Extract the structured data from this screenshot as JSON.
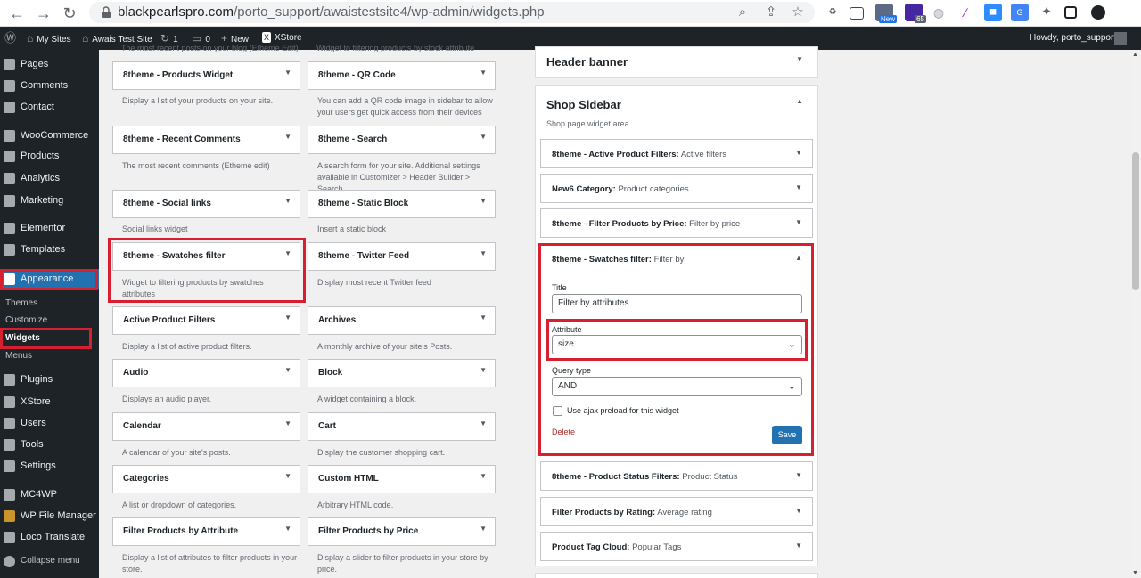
{
  "browser": {
    "url_host": "blackpearlspro.com",
    "url_path": "/porto_support/awaistestsite4/wp-admin/widgets.php",
    "ext_new_badge": "New",
    "ext_count_badge": "65"
  },
  "admin_bar": {
    "my_sites": "My Sites",
    "site_name": "Awais Test Site",
    "updates_count": "1",
    "comments_count": "0",
    "new_label": "New",
    "xstore_label": "XStore",
    "howdy": "Howdy, porto_support"
  },
  "sidebar": {
    "items": [
      {
        "label": "Pages"
      },
      {
        "label": "Comments"
      },
      {
        "label": "Contact"
      },
      {
        "label": "WooCommerce"
      },
      {
        "label": "Products"
      },
      {
        "label": "Analytics"
      },
      {
        "label": "Marketing"
      },
      {
        "label": "Elementor"
      },
      {
        "label": "Templates"
      },
      {
        "label": "Appearance"
      },
      {
        "label": "Plugins"
      },
      {
        "label": "XStore"
      },
      {
        "label": "Users"
      },
      {
        "label": "Tools"
      },
      {
        "label": "Settings"
      },
      {
        "label": "MC4WP"
      },
      {
        "label": "WP File Manager"
      },
      {
        "label": "Loco Translate"
      },
      {
        "label": "Collapse menu"
      }
    ],
    "submenu": [
      {
        "label": "Themes"
      },
      {
        "label": "Customize"
      },
      {
        "label": "Widgets"
      },
      {
        "label": "Menus"
      }
    ]
  },
  "available_widgets": {
    "top_desc_left": "The most recent posts on your blog (Etheme Edit)",
    "top_desc_right": "Widget to filtering products by stock attribute",
    "widgets": [
      {
        "title": "8theme - Products Widget",
        "desc": "Display a list of your products on your site."
      },
      {
        "title": "8theme - QR Code",
        "desc": "You can add a QR code image in sidebar to allow your users get quick access from their devices"
      },
      {
        "title": "8theme - Recent Comments",
        "desc": "The most recent comments (Etheme edit)"
      },
      {
        "title": "8theme - Search",
        "desc": "A search form for your site. Additional settings available in Customizer > Header Builder > Search"
      },
      {
        "title": "8theme - Social links",
        "desc": "Social links widget"
      },
      {
        "title": "8theme - Static Block",
        "desc": "Insert a static block"
      },
      {
        "title": "8theme - Swatches filter",
        "desc": "Widget to filtering products by swatches attributes"
      },
      {
        "title": "8theme - Twitter Feed",
        "desc": "Display most recent Twitter feed"
      },
      {
        "title": "Active Product Filters",
        "desc": "Display a list of active product filters."
      },
      {
        "title": "Archives",
        "desc": "A monthly archive of your site's Posts."
      },
      {
        "title": "Audio",
        "desc": "Displays an audio player."
      },
      {
        "title": "Block",
        "desc": "A widget containing a block."
      },
      {
        "title": "Calendar",
        "desc": "A calendar of your site's posts."
      },
      {
        "title": "Cart",
        "desc": "Display the customer shopping cart."
      },
      {
        "title": "Categories",
        "desc": "A list or dropdown of categories."
      },
      {
        "title": "Custom HTML",
        "desc": "Arbitrary HTML code."
      },
      {
        "title": "Filter Products by Attribute",
        "desc": "Display a list of attributes to filter products in your store."
      },
      {
        "title": "Filter Products by Price",
        "desc": "Display a slider to filter products in your store by price."
      }
    ]
  },
  "header_banner": {
    "title": "Header banner"
  },
  "shop_sidebar": {
    "title": "Shop Sidebar",
    "desc": "Shop page widget area",
    "widgets": [
      {
        "name": "8theme - Active Product Filters:",
        "sub": "Active filters"
      },
      {
        "name": "New6 Category:",
        "sub": "Product categories"
      },
      {
        "name": "8theme - Filter Products by Price:",
        "sub": "Filter by price"
      },
      {
        "name": "8theme - Swatches filter:",
        "sub": "Filter by"
      },
      {
        "name": "8theme - Product Status Filters:",
        "sub": "Product Status"
      },
      {
        "name": "Filter Products by Rating:",
        "sub": "Average rating"
      },
      {
        "name": "Product Tag Cloud:",
        "sub": "Popular Tags"
      }
    ],
    "form": {
      "title_label": "Title",
      "title_value": "Filter by attributes",
      "attribute_label": "Attribute",
      "attribute_value": "size",
      "query_label": "Query type",
      "query_value": "AND",
      "ajax_label": "Use ajax preload for this widget",
      "delete_label": "Delete",
      "save_label": "Save"
    }
  },
  "colors": {
    "accent": "#2271b1",
    "highlight": "#d7202f",
    "admin_bg": "#1d2327"
  }
}
